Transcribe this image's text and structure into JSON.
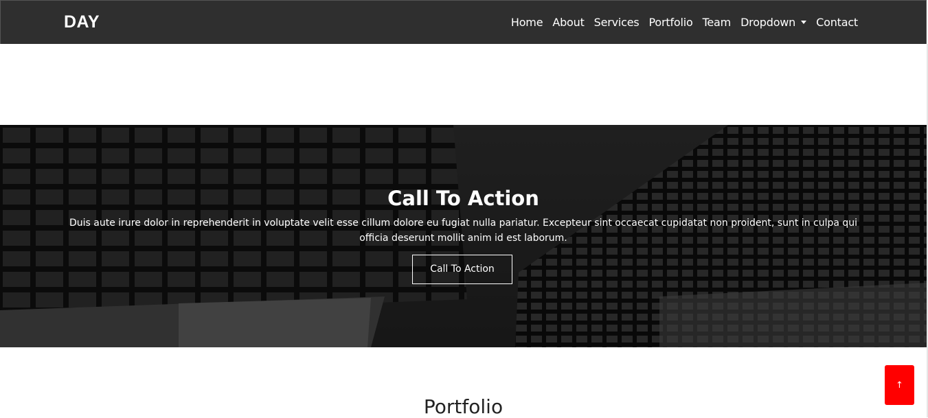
{
  "header": {
    "logo": "DAY",
    "nav": [
      {
        "label": "Home"
      },
      {
        "label": "About"
      },
      {
        "label": "Services"
      },
      {
        "label": "Portfolio"
      },
      {
        "label": "Team"
      },
      {
        "label": "Dropdown",
        "has_caret": true
      },
      {
        "label": "Contact"
      }
    ]
  },
  "hero": {
    "title": "Call To Action",
    "text": "Duis aute irure dolor in reprehenderit in voluptate velit esse cillum dolore eu fugiat nulla pariatur. Excepteur sint occaecat cupidatat non proident, sunt in culpa qui officia deserunt mollit anim id est laborum.",
    "button_label": "Call To Action"
  },
  "portfolio": {
    "title": "Portfolio"
  },
  "back_to_top": {
    "icon": "arrow-up-icon",
    "glyph": "↑",
    "color": "#ff0000"
  },
  "colors": {
    "header_bg": "#2f2f2f",
    "hero_overlay": "#000000"
  }
}
